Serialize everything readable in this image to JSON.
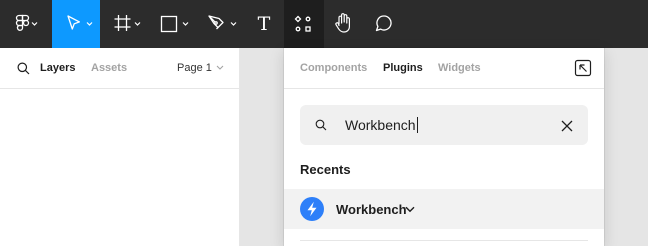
{
  "toolbar": {
    "tools": [
      {
        "name": "main-menu",
        "icon": "figma-logo-icon",
        "has_dropdown": true
      },
      {
        "name": "move",
        "icon": "move-arrow-icon",
        "has_dropdown": true,
        "active": true
      },
      {
        "name": "frame",
        "icon": "frame-hash-icon",
        "has_dropdown": true
      },
      {
        "name": "shape",
        "icon": "rectangle-icon",
        "has_dropdown": true
      },
      {
        "name": "pen",
        "icon": "pen-nib-icon",
        "has_dropdown": true
      },
      {
        "name": "text",
        "icon": "text-t-icon",
        "has_dropdown": false
      },
      {
        "name": "resources",
        "icon": "resources-icon",
        "has_dropdown": false,
        "selected": true
      },
      {
        "name": "hand",
        "icon": "hand-icon",
        "has_dropdown": false
      },
      {
        "name": "comment",
        "icon": "comment-bubble-icon",
        "has_dropdown": false
      }
    ],
    "text_tool_glyph": "T",
    "accent_color": "#0d99ff",
    "background_color": "#2c2c2c"
  },
  "left_panel": {
    "tabs": [
      "Layers",
      "Assets"
    ],
    "active_tab": "Layers",
    "page_selector": "Page 1"
  },
  "plugins_panel": {
    "tabs": [
      "Components",
      "Plugins",
      "Widgets"
    ],
    "active_tab": "Plugins",
    "search": {
      "value": "Workbench",
      "placeholder": "Search"
    },
    "section_title": "Recents",
    "recents": [
      {
        "label": "Workbench",
        "icon": "workbench-bolt-icon",
        "icon_color": "#2d7ff9"
      }
    ]
  }
}
